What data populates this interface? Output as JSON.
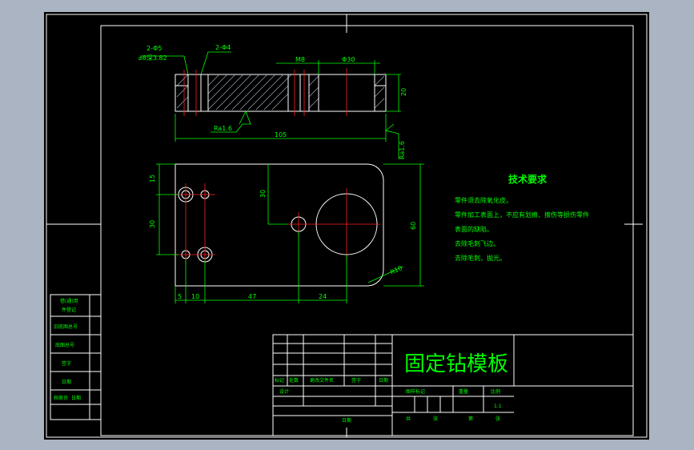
{
  "colors": {
    "background": "#aab4c3",
    "drawing_bg": "#000000",
    "line": "#ffffff",
    "dim": "#00ff00",
    "center": "#ff2020"
  },
  "top_view": {
    "dim_hole_left": "2-Φ5",
    "dim_counterbore": "⌀8深3.82",
    "dim_hole_right": "2-Φ4",
    "dim_m8": "M8",
    "dim_d30": "Φ30",
    "dim_height": "20",
    "dim_length": "105",
    "roughness_1": "Ra1.6",
    "roughness_2": "Ra1.6"
  },
  "front_view": {
    "dim_15": "15",
    "dim_30_left": "30",
    "dim_30_mid": "30",
    "dim_60": "60",
    "dim_5": "5",
    "dim_10": "10",
    "dim_47": "47",
    "dim_24": "24",
    "dim_r10": "R10"
  },
  "tech": {
    "title": "技术要求",
    "lines": [
      "零件须去除氧化皮。",
      "零件加工表面上，不应有划痕、擦伤等损伤零件",
      "表面的缺陷。",
      "去除毛刺飞边。",
      "去除毛刺，抛光。"
    ]
  },
  "left_table": [
    "借(通)用",
    "件登记",
    "旧底图总号",
    "底图总号",
    "签字",
    "日期",
    "档案员",
    "日期"
  ],
  "title_block": {
    "part_name": "固定钻模板",
    "c_biaoji": "标记",
    "c_chushu": "处数",
    "c_gengai": "更改文件名",
    "c_qianzi": "签字",
    "c_riqi": "日期",
    "c_sheji": "设计",
    "c_riqi2": "日期",
    "c_tuyang": "图样标记",
    "c_zhongliang": "重量",
    "c_bili": "比例",
    "scale": "1:1",
    "c_gong": "共",
    "c_zhang": "张",
    "c_di": "第",
    "c_zhang2": "张"
  }
}
